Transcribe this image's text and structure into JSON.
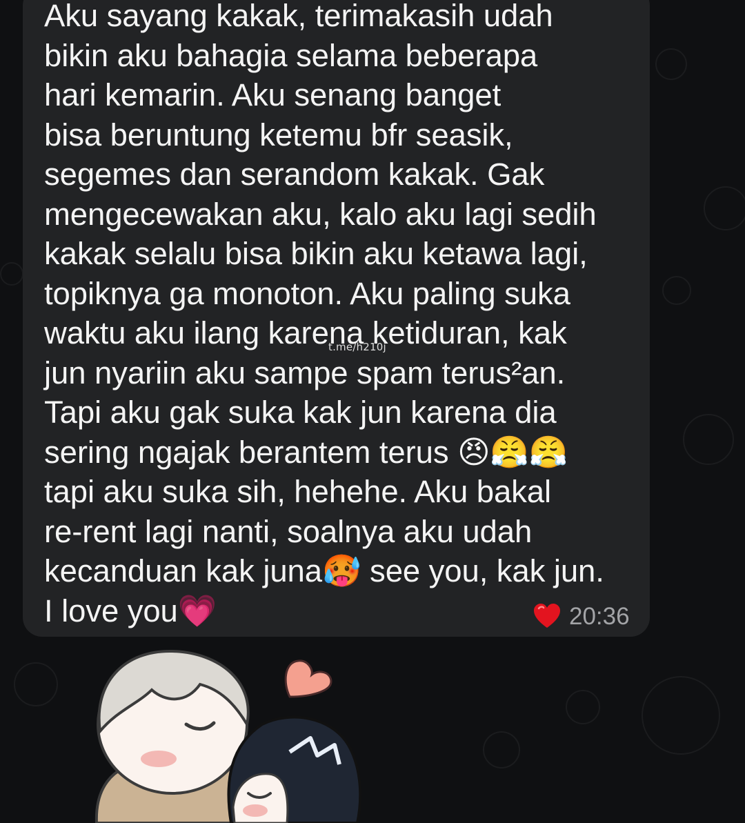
{
  "message": {
    "text": "Aku sayang kakak, terimakasih udah\nbikin aku bahagia selama beberapa\nhari kemarin. Aku senang banget\nbisa beruntung ketemu bfr seasik,\nsegemes dan serandom kakak. Gak\nmengecewakan aku, kalo aku lagi sedih\nkakak selalu bisa bikin aku ketawa lagi,\ntopiknya ga monoton. Aku paling suka\nwaktu aku ilang karena ketiduran, kak\njun nyariin aku sampe spam terus²an.\nTapi aku gak suka kak jun karena dia\nsering ngajak berantem terus 😠😤😤\ntapi aku suka sih, hehehe. Aku bakal\nre-rent lagi nanti, soalnya aku udah\nkecanduan kak juna🥵 see you, kak jun.\nI love you💗",
    "watermark": "t.me/h210j",
    "reaction_icon": "red-heart-icon",
    "time": "20:36"
  },
  "sticker": {
    "icon": "kissing-couple-sticker"
  },
  "colors": {
    "background": "#0f1012",
    "bubble": "#222325",
    "text": "#f4f4f4",
    "timestamp": "#a3a4a7",
    "heart": "#e3141f"
  }
}
